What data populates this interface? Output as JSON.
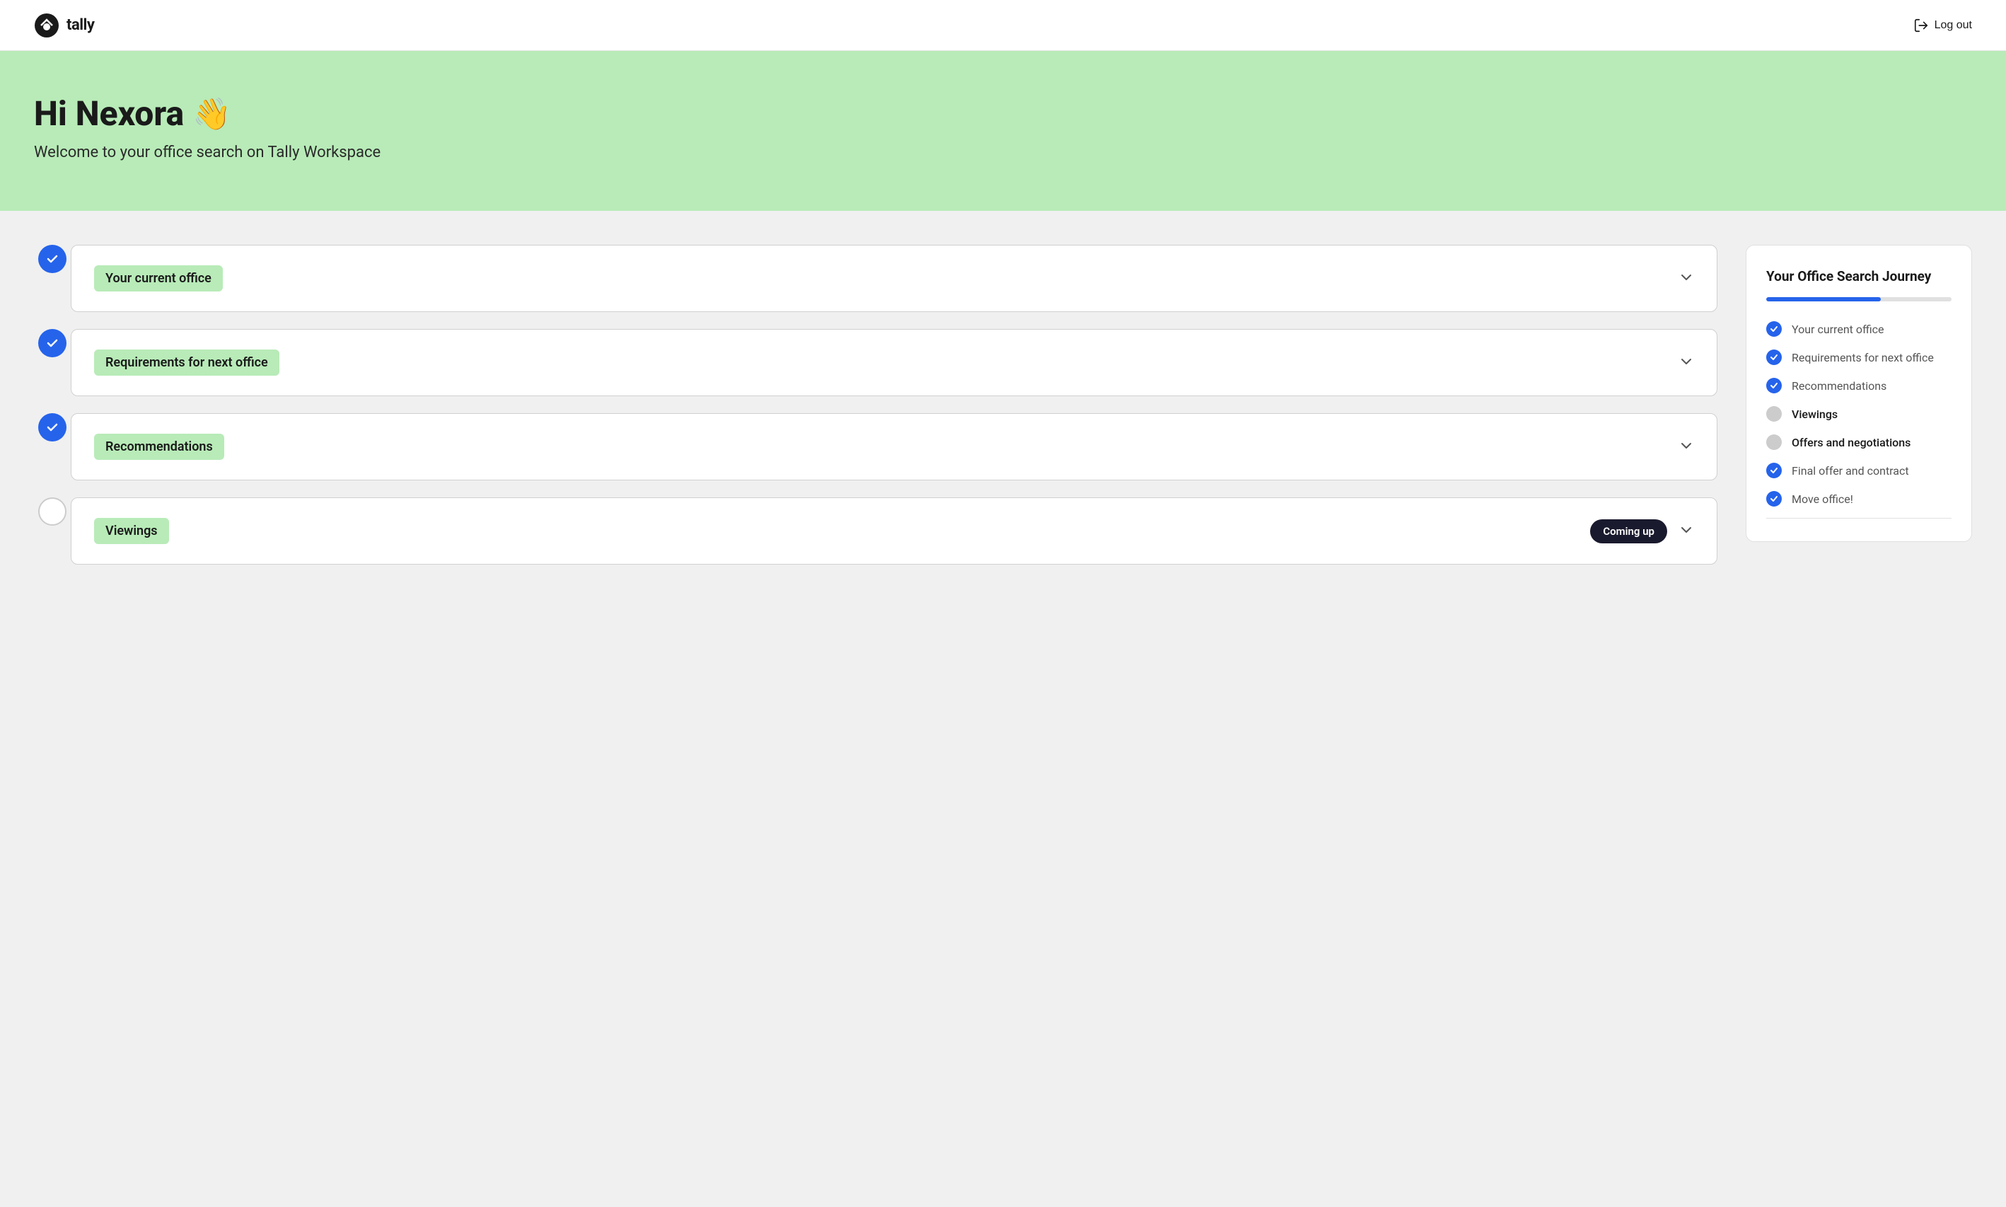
{
  "header": {
    "logo_text": "tally",
    "logout_label": "Log out"
  },
  "hero": {
    "greeting": "Hi Nexora",
    "wave_emoji": "👋",
    "subtitle": "Welcome to your office search on Tally Workspace"
  },
  "timeline": {
    "items": [
      {
        "id": "current-office",
        "label": "Your current office",
        "completed": true,
        "coming_up": false
      },
      {
        "id": "requirements",
        "label": "Requirements for next office",
        "completed": true,
        "coming_up": false
      },
      {
        "id": "recommendations",
        "label": "Recommendations",
        "completed": true,
        "coming_up": false
      },
      {
        "id": "viewings",
        "label": "Viewings",
        "completed": false,
        "coming_up": true,
        "coming_up_label": "Coming up"
      }
    ]
  },
  "journey_panel": {
    "title": "Your Office Search Journey",
    "progress_percent": 62,
    "items": [
      {
        "label": "Your current office",
        "completed": true
      },
      {
        "label": "Requirements for next office",
        "completed": true
      },
      {
        "label": "Recommendations",
        "completed": true
      },
      {
        "label": "Viewings",
        "completed": false
      },
      {
        "label": "Offers and negotiations",
        "completed": false
      },
      {
        "label": "Final offer and contract",
        "completed": true
      },
      {
        "label": "Move office!",
        "completed": true
      }
    ]
  }
}
